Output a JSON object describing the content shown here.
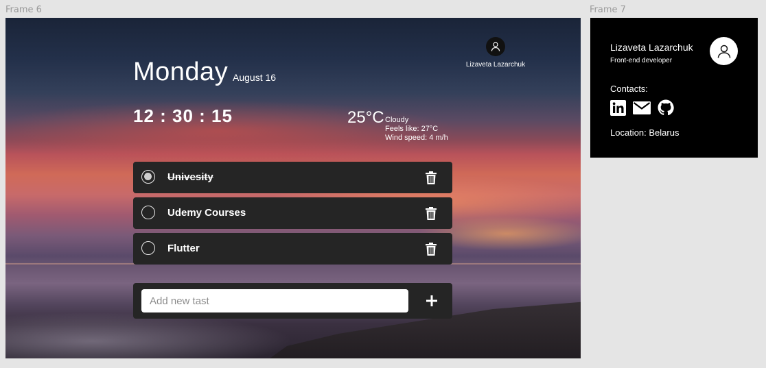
{
  "frames": {
    "frame6_label": "Frame 6",
    "frame7_label": "Frame 7"
  },
  "dashboard": {
    "day": "Monday",
    "date": "August 16",
    "time": "12 : 30 : 15",
    "user_name": "Lizaveta Lazarchuk",
    "weather": {
      "temperature": "25°C",
      "condition": "Cloudy",
      "feels_like": "Feels like: 27°C",
      "wind_speed": "Wind speed: 4 m/h"
    },
    "tasks": [
      {
        "label": "Univesity",
        "done": true
      },
      {
        "label": "Udemy Courses",
        "done": false
      },
      {
        "label": "Flutter",
        "done": false
      }
    ],
    "add_task": {
      "placeholder": "Add new tast",
      "button_icon": "plus-icon"
    }
  },
  "profile": {
    "name": "Lizaveta Lazarchuk",
    "role": "Front-end developer",
    "contacts_label": "Contacts:",
    "contact_icons": [
      "linkedin-icon",
      "mail-icon",
      "github-icon"
    ],
    "location": "Location: Belarus"
  },
  "colors": {
    "task_bg": "#252525",
    "page_bg": "#e5e5e5",
    "profile_bg": "#000000"
  }
}
